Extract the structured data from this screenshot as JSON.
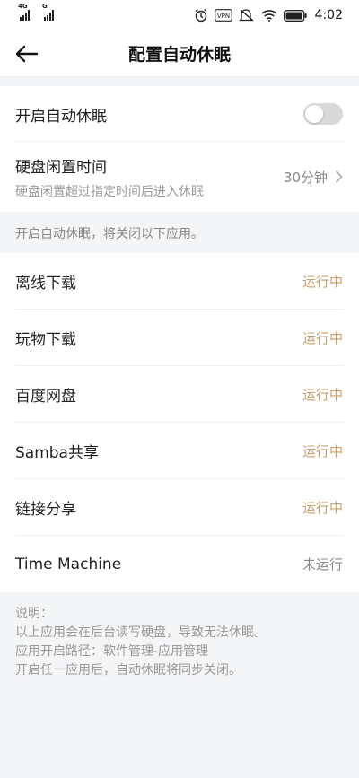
{
  "status_bar": {
    "sim1_label": "4G",
    "sim2_label": "G",
    "vpn_label": "VPN",
    "time": "4:02"
  },
  "header": {
    "title": "配置自动休眠"
  },
  "settings": {
    "auto_sleep_label": "开启自动休眠",
    "auto_sleep_enabled": false,
    "idle_time_label": "硬盘闲置时间",
    "idle_time_desc": "硬盘闲置超过指定时间后进入休眠",
    "idle_time_value": "30分钟"
  },
  "note": "开启自动休眠，将关闭以下应用。",
  "apps": [
    {
      "name": "离线下载",
      "status": "运行中",
      "running": true
    },
    {
      "name": "玩物下载",
      "status": "运行中",
      "running": true
    },
    {
      "name": "百度网盘",
      "status": "运行中",
      "running": true
    },
    {
      "name": "Samba共享",
      "status": "运行中",
      "running": true
    },
    {
      "name": "链接分享",
      "status": "运行中",
      "running": true
    },
    {
      "name": "Time Machine",
      "status": "未运行",
      "running": false
    }
  ],
  "explanation": {
    "title": "说明：",
    "lines": [
      "以上应用会在后台读写硬盘，导致无法休眠。",
      "应用开启路径：软件管理-应用管理",
      "开启任一应用后，自动休眠将同步关闭。"
    ]
  },
  "colors": {
    "running": "#c9a06a",
    "stopped": "#888888"
  }
}
